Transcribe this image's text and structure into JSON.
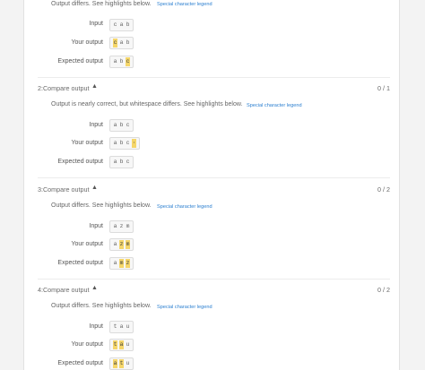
{
  "colors": {
    "highlight": "#f5d66a",
    "legend_link": "#2b7fd0"
  },
  "labels": {
    "input": "Input",
    "your_output": "Your output",
    "expected_output": "Expected output"
  },
  "sections": [
    {
      "title": "",
      "score": "",
      "message": "Output differs. See highlights below.",
      "legend": "Special character legend",
      "input": [
        {
          "c": "c",
          "hl": false
        },
        {
          "c": "a",
          "hl": false
        },
        {
          "c": "b",
          "hl": false
        }
      ],
      "your_output": [
        {
          "c": "c",
          "hl": true
        },
        {
          "c": "a",
          "hl": false
        },
        {
          "c": "b",
          "hl": false
        }
      ],
      "expected_output": [
        {
          "c": "a",
          "hl": false
        },
        {
          "c": "b",
          "hl": false
        },
        {
          "c": "c",
          "hl": true
        }
      ]
    },
    {
      "title": "2:Compare output",
      "score": "0 / 1",
      "message": "Output is nearly correct, but whitespace differs. See highlights below.",
      "legend": "Special character legend",
      "input": [
        {
          "c": "a",
          "hl": false
        },
        {
          "c": "b",
          "hl": false
        },
        {
          "c": "c",
          "hl": false
        }
      ],
      "your_output": [
        {
          "c": "a",
          "hl": false
        },
        {
          "c": "b",
          "hl": false
        },
        {
          "c": "c",
          "hl": false
        },
        {
          "c": "·",
          "hl": true
        }
      ],
      "expected_output": [
        {
          "c": "a",
          "hl": false
        },
        {
          "c": "b",
          "hl": false
        },
        {
          "c": "c",
          "hl": false
        }
      ]
    },
    {
      "title": "3:Compare output",
      "score": "0 / 2",
      "message": "Output differs. See highlights below.",
      "legend": "Special character legend",
      "input": [
        {
          "c": "a",
          "hl": false
        },
        {
          "c": "z",
          "hl": false
        },
        {
          "c": "m",
          "hl": false
        }
      ],
      "your_output": [
        {
          "c": "a",
          "hl": false
        },
        {
          "c": "z",
          "hl": true
        },
        {
          "c": "m",
          "hl": true
        }
      ],
      "expected_output": [
        {
          "c": "a",
          "hl": false
        },
        {
          "c": "m",
          "hl": true
        },
        {
          "c": "z",
          "hl": true
        }
      ]
    },
    {
      "title": "4:Compare output",
      "score": "0 / 2",
      "message": "Output differs. See highlights below.",
      "legend": "Special character legend",
      "input": [
        {
          "c": "t",
          "hl": false
        },
        {
          "c": "a",
          "hl": false
        },
        {
          "c": "u",
          "hl": false
        }
      ],
      "your_output": [
        {
          "c": "t",
          "hl": true
        },
        {
          "c": "a",
          "hl": true
        },
        {
          "c": "u",
          "hl": false
        }
      ],
      "expected_output": [
        {
          "c": "a",
          "hl": true
        },
        {
          "c": "t",
          "hl": true
        },
        {
          "c": "u",
          "hl": false
        }
      ]
    }
  ]
}
